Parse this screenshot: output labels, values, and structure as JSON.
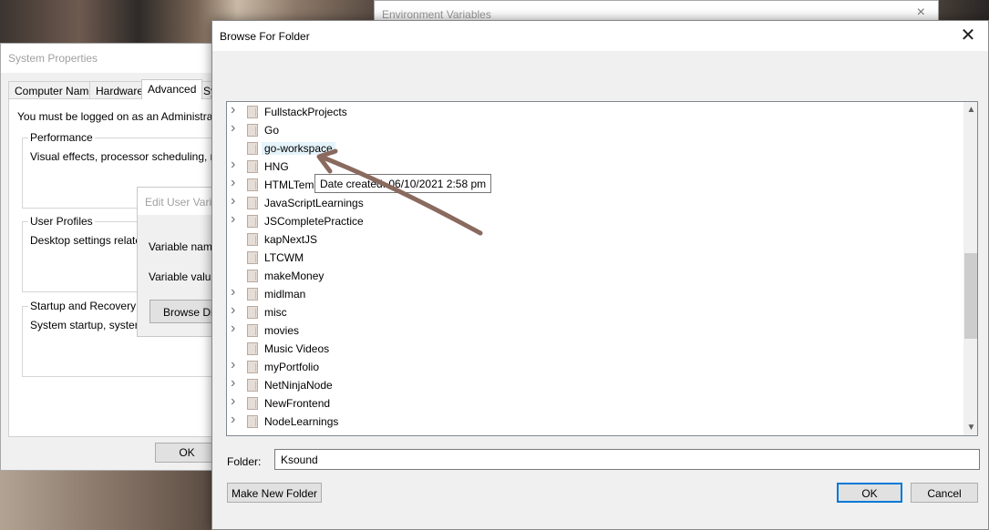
{
  "env_window": {
    "title": "Environment Variables",
    "close": "×"
  },
  "system_properties": {
    "title": "System Properties",
    "tabs": [
      "Computer Name",
      "Hardware",
      "Advanced",
      "Sy"
    ],
    "admin_note": "You must be logged on as an Administrator t",
    "performance": {
      "label": "Performance",
      "text": "Visual effects, processor scheduling, memo"
    },
    "user_profiles": {
      "label": "User Profiles",
      "text": "Desktop settings related t"
    },
    "startup": {
      "label": "Startup and Recovery",
      "text": "System startup, system fa"
    },
    "ok": "OK"
  },
  "edit_user_variable": {
    "title": "Edit User Varia",
    "variable_name": "Variable nam",
    "variable_value": "Variable value",
    "browse_dir": "Browse Di"
  },
  "browse_for_folder": {
    "title": "Browse For Folder",
    "close": "✕",
    "tree_items": [
      {
        "label": "FullstackProjects",
        "expandable": true
      },
      {
        "label": "Go",
        "expandable": true
      },
      {
        "label": "go-workspace",
        "expandable": false,
        "hovered": true
      },
      {
        "label": "HNG",
        "expandable": true
      },
      {
        "label": "HTMLTemp",
        "expandable": true
      },
      {
        "label": "JavaScriptLearnings",
        "expandable": true
      },
      {
        "label": "JSCompletePractice",
        "expandable": true
      },
      {
        "label": "kapNextJS",
        "expandable": false
      },
      {
        "label": "LTCWM",
        "expandable": false
      },
      {
        "label": "makeMoney",
        "expandable": false
      },
      {
        "label": "midlman",
        "expandable": true
      },
      {
        "label": "misc",
        "expandable": true
      },
      {
        "label": "movies",
        "expandable": true
      },
      {
        "label": "Music Videos",
        "expandable": false
      },
      {
        "label": "myPortfolio",
        "expandable": true
      },
      {
        "label": "NetNinjaNode",
        "expandable": true
      },
      {
        "label": "NewFrontend",
        "expandable": true
      },
      {
        "label": "NodeLearnings",
        "expandable": true
      }
    ],
    "tooltip": "Date created: 06/10/2021 2:58 pm",
    "folder_label": "Folder:",
    "folder_value": "Ksound",
    "make_new_folder": "Make New Folder",
    "ok": "OK",
    "cancel": "Cancel"
  },
  "colors": {
    "annotation_arrow": "#8a6a5e",
    "default_button_border": "#0078d7"
  }
}
